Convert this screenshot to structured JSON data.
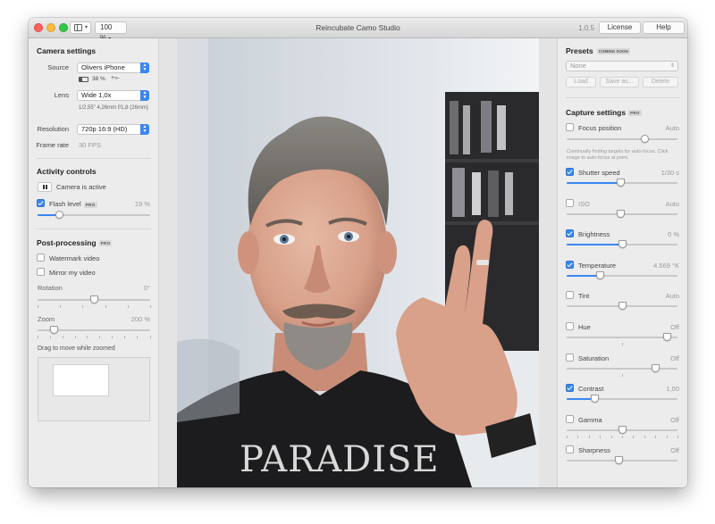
{
  "window": {
    "title": "Reincubate Camo Studio",
    "version": "1.0.5",
    "zoom": "100 %",
    "license_label": "License",
    "help_label": "Help"
  },
  "camera_settings": {
    "title": "Camera settings",
    "source_label": "Source",
    "source_value": "Olivers iPhone",
    "battery": "38 %",
    "lens_label": "Lens",
    "lens_value": "Wide 1,0x",
    "lens_info": "1/2,55\" 4,26mm f/1,8 (26mm)",
    "resolution_label": "Resolution",
    "resolution_value": "720p 16:9 (HD)",
    "framerate_label": "Frame rate",
    "framerate_value": "30 FPS"
  },
  "activity_controls": {
    "title": "Activity controls",
    "camera_status": "Camera is active",
    "flash_label": "Flash level",
    "flash_badge": "PRO",
    "flash_value": "19 %",
    "flash_level": 0.19
  },
  "post_processing": {
    "title": "Post-processing",
    "badge": "PRO",
    "watermark_label": "Watermark video",
    "mirror_label": "Mirror my video",
    "rotation_label": "Rotation",
    "rotation_value": "0°",
    "zoom_label": "Zoom",
    "zoom_value": "200 %",
    "drag_label": "Drag to move while zoomed"
  },
  "presets": {
    "title": "Presets",
    "badge": "COMING SOON",
    "select_value": "None",
    "load_label": "Load",
    "save_label": "Save as...",
    "delete_label": "Delete"
  },
  "capture_settings": {
    "title": "Capture settings",
    "badge": "PRO",
    "focus_label": "Focus position",
    "focus_value": "Auto",
    "focus_hint": "Continually finding targets for auto-focus. Click image to auto-focus at point.",
    "items": [
      {
        "label": "Shutter speed",
        "value": "1/30 s",
        "checked": true,
        "level": 0.48
      },
      {
        "label": "ISO",
        "value": "Auto",
        "checked": false,
        "level": 0.48
      },
      {
        "label": "Brightness",
        "value": "0 %",
        "checked": true,
        "level": 0.5
      },
      {
        "label": "Temperature",
        "value": "4.569 °K",
        "checked": true,
        "level": 0.3
      },
      {
        "label": "Tint",
        "value": "Auto",
        "checked": false,
        "level": 0.5
      },
      {
        "label": "Hue",
        "value": "Off",
        "checked": false,
        "level": 0.9
      },
      {
        "label": "Saturation",
        "value": "Off",
        "checked": false,
        "level": 0.8
      },
      {
        "label": "Contrast",
        "value": "1,00",
        "checked": true,
        "level": 0.25
      },
      {
        "label": "Gamma",
        "value": "Off",
        "checked": false,
        "level": 0.5
      },
      {
        "label": "Sharpness",
        "value": "Off",
        "checked": false,
        "level": 0.47
      }
    ]
  },
  "video": {
    "shirt_text": "PARADISE"
  },
  "colors": {
    "accent": "#3a87f2",
    "panel_bg": "#ececec"
  }
}
